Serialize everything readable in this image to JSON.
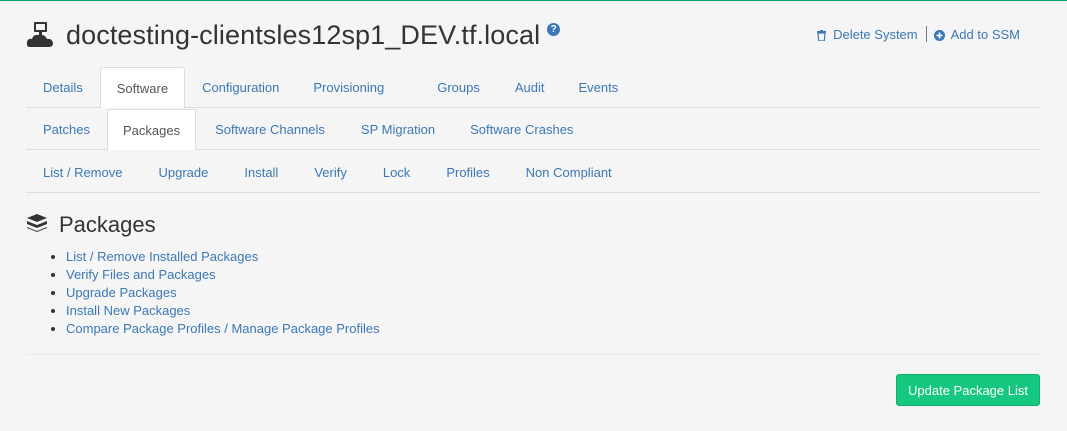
{
  "header": {
    "title": "doctesting-clientsles12sp1_DEV.tf.local",
    "help_icon": "question-circle-icon",
    "actions": [
      {
        "label": "Delete System",
        "icon": "trash-icon"
      },
      {
        "label": "Add to SSM",
        "icon": "plus-circle-icon"
      }
    ]
  },
  "tabs_primary": [
    "Details",
    "Software",
    "Configuration",
    "Provisioning",
    "Groups",
    "Audit",
    "Events"
  ],
  "tabs_secondary": [
    "Patches",
    "Packages",
    "Software Channels",
    "SP Migration",
    "Software Crashes"
  ],
  "tabs_tertiary": [
    "List / Remove",
    "Upgrade",
    "Install",
    "Verify",
    "Lock",
    "Profiles",
    "Non Compliant"
  ],
  "active": {
    "primary": "Software",
    "secondary": "Packages"
  },
  "section": {
    "title": "Packages",
    "icon": "packages-icon",
    "links": [
      "List / Remove Installed Packages",
      "Verify Files and Packages",
      "Upgrade Packages",
      "Install New Packages",
      "Compare Package Profiles / Manage Package Profiles"
    ]
  },
  "button": {
    "update_label": "Update Package List"
  },
  "colors": {
    "accent": "#16c87f",
    "link": "#3b78b4",
    "top_border": "#00a36c"
  }
}
